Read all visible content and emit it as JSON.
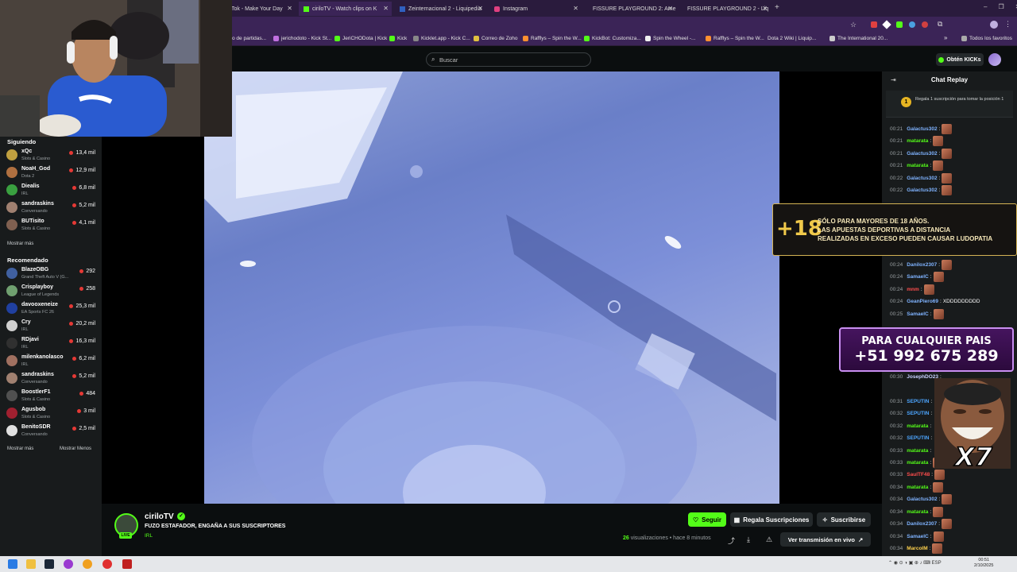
{
  "browser": {
    "tabs": [
      {
        "title": "Tok - Make Your Day",
        "active": false
      },
      {
        "title": "ciriloTV - Watch clips on K",
        "active": true
      },
      {
        "title": "Zeinternacional 2 - Liquipedia",
        "active": false
      },
      {
        "title": "Instagram",
        "active": false
      },
      {
        "title": "FISSURE PLAYGROUND 2: Ame",
        "active": false
      },
      {
        "title": "FISSURE PLAYGROUND 2 - Liq",
        "active": false
      }
    ],
    "new_tab": "+",
    "bookmarks": [
      "o de partidas...",
      "jerichodoto - Kick St...",
      "JeriCHODota | Kick",
      "Kick",
      "Kicklet.app - Kick C...",
      "Correo de Zoho",
      "Rafflys – Spin the W...",
      "KickBot: Customiza...",
      "Spin the Wheel -...",
      "Rafflys – Spin the W...",
      "Dota 2 Wiki | Liquip...",
      "The International 20..."
    ],
    "bookmarks_more": "»",
    "all_favorites": "Todos los favoritos",
    "window_controls": [
      "–",
      "❐",
      "✕"
    ]
  },
  "kick_header": {
    "search_placeholder": "Buscar",
    "get_kicks": "Obtén KICKs"
  },
  "sidebar": {
    "following_title": "Siguiendo",
    "following": [
      {
        "name": "xQc",
        "category": "Slots & Casino",
        "viewers": "13,4 mil",
        "color": "#c0a040"
      },
      {
        "name": "NoaH_God",
        "category": "Dota 2",
        "viewers": "12,9 mil",
        "color": "#b07040"
      },
      {
        "name": "Diealis",
        "category": "IRL",
        "viewers": "6,8 mil",
        "color": "#3aa040"
      },
      {
        "name": "sandraskins",
        "category": "Conversando",
        "viewers": "5,2 mil",
        "color": "#a08070"
      },
      {
        "name": "BUTisito",
        "category": "Slots & Casino",
        "viewers": "4,1 mil",
        "color": "#806050"
      }
    ],
    "show_more_1": "Mostrar más",
    "recommended_title": "Recomendado",
    "recommended": [
      {
        "name": "BlazeOBG",
        "category": "Grand Theft Auto V (G...",
        "viewers": "292",
        "color": "#4060a0"
      },
      {
        "name": "Crisplayboy",
        "category": "League of Legends",
        "viewers": "258",
        "color": "#70a070"
      },
      {
        "name": "davooxeneize",
        "category": "EA Sports FC 26",
        "viewers": "25,3 mil",
        "color": "#2040a0"
      },
      {
        "name": "Cry",
        "category": "IRL",
        "viewers": "20,2 mil",
        "color": "#d0d0d0"
      },
      {
        "name": "RDjavi",
        "category": "IRL",
        "viewers": "16,3 mil",
        "color": "#303030"
      },
      {
        "name": "milenkanolasco",
        "category": "IRL",
        "viewers": "6,2 mil",
        "color": "#a07060"
      },
      {
        "name": "sandraskins",
        "category": "Conversando",
        "viewers": "5,2 mil",
        "color": "#a08070"
      },
      {
        "name": "BoostlerF1",
        "category": "Slots & Casino",
        "viewers": "484",
        "color": "#505050"
      },
      {
        "name": "Agusbob",
        "category": "Slots & Casino",
        "viewers": "3 mil",
        "color": "#a02030"
      },
      {
        "name": "BenitoSDR",
        "category": "Conversando",
        "viewers": "2,5 mil",
        "color": "#e0e0e0"
      }
    ],
    "show_more_2": "Mostrar más",
    "show_less": "Mostrar Menos"
  },
  "stream": {
    "channel": "ciriloTV",
    "title": "FUZO ESTAFADOR, ENGAÑA A SUS SUSCRIPTORES",
    "category": "IRL",
    "live_badge": "LIVE",
    "follow": "Seguir",
    "gift_subs": "Regala Suscripciones",
    "subscribe": "Suscribirse",
    "view_count": "26",
    "views_suffix": "visualizaciones • hace 8 minutos",
    "watch_live": "Ver transmisión en vivo"
  },
  "chat": {
    "title": "Chat Replay",
    "pinned_rank": "1",
    "pinned_text": "Regala 1 suscripción para tomar la posición 1",
    "messages": [
      {
        "time": "00:21",
        "user": "Galactus302",
        "color": "#7fb3ff",
        "text": "",
        "emote": true
      },
      {
        "time": "00:21",
        "user": "matarata",
        "color": "#53fc18",
        "text": "",
        "emote": true
      },
      {
        "time": "00:21",
        "user": "Galactus302",
        "color": "#7fb3ff",
        "text": "",
        "emote": true
      },
      {
        "time": "00:21",
        "user": "matarata",
        "color": "#53fc18",
        "text": "",
        "emote": true
      },
      {
        "time": "00:22",
        "user": "Galactus302",
        "color": "#7fb3ff",
        "text": "",
        "emote": true
      },
      {
        "time": "00:22",
        "user": "Galactus302",
        "color": "#7fb3ff",
        "text": "",
        "emote": true
      },
      {
        "time": "00:24",
        "user": "Danilox2307",
        "color": "#7fb3ff",
        "text": "",
        "emote": true
      },
      {
        "time": "00:24",
        "user": "SamaelC",
        "color": "#7fb3ff",
        "text": "",
        "emote": true
      },
      {
        "time": "00:24",
        "user": "mnm",
        "color": "#ff4d4d",
        "text": "",
        "emote": true
      },
      {
        "time": "00:24",
        "user": "GeanPiero69",
        "color": "#7fb3ff",
        "text": "XDDDDDDDDD",
        "emote": false
      },
      {
        "time": "00:25",
        "user": "SamaelC",
        "color": "#7fb3ff",
        "text": "",
        "emote": true
      },
      {
        "time": "00:30",
        "user": "JosephDO23",
        "color": "#c9d1ff",
        "text": "",
        "emote": false
      },
      {
        "time": "00:31",
        "user": "SEPUTIN",
        "color": "#4da6ff",
        "text": "",
        "emote": false
      },
      {
        "time": "00:32",
        "user": "SEPUTIN",
        "color": "#4da6ff",
        "text": "",
        "emote": false
      },
      {
        "time": "00:32",
        "user": "matarata",
        "color": "#53fc18",
        "text": "",
        "emote": false
      },
      {
        "time": "00:32",
        "user": "SEPUTIN",
        "color": "#4da6ff",
        "text": "",
        "emote": false
      },
      {
        "time": "00:33",
        "user": "matarata",
        "color": "#53fc18",
        "text": "",
        "emote": false
      },
      {
        "time": "00:33",
        "user": "matarata",
        "color": "#53fc18",
        "text": "",
        "emote": true
      },
      {
        "time": "00:33",
        "user": "SaulTF48",
        "color": "#ff4d4d",
        "text": "",
        "emote": true
      },
      {
        "time": "00:34",
        "user": "matarata",
        "color": "#53fc18",
        "text": "",
        "emote": true
      },
      {
        "time": "00:34",
        "user": "Galactus302",
        "color": "#7fb3ff",
        "text": "",
        "emote": true
      },
      {
        "time": "00:34",
        "user": "matarata",
        "color": "#53fc18",
        "text": "",
        "emote": true
      },
      {
        "time": "00:34",
        "user": "Danilox2307",
        "color": "#7fb3ff",
        "text": "",
        "emote": true
      },
      {
        "time": "00:34",
        "user": "SamaelC",
        "color": "#7fb3ff",
        "text": "",
        "emote": true
      },
      {
        "time": "00:34",
        "user": "MarcolM",
        "color": "#ffd24d",
        "text": "",
        "emote": true
      }
    ]
  },
  "overlays": {
    "age_big": "+18",
    "age_line1": "SÓLO PARA MAYORES DE 18 AÑOS.",
    "age_line2": "LAS APUESTAS DEPORTIVAS A DISTANCIA",
    "age_line3": "REALIZADAS EN EXCESO PUEDEN CAUSAR LUDOPATIA",
    "phone_line1": "PARA CUALQUIER PAIS",
    "phone_line2": "+51 992 675 289",
    "meme_text": "X7"
  },
  "taskbar": {
    "lang": "ESP",
    "time": "00:51",
    "date": "2/10/2025"
  },
  "colors": {
    "kick_green": "#53fc18",
    "browser_purple": "#3b2457"
  }
}
